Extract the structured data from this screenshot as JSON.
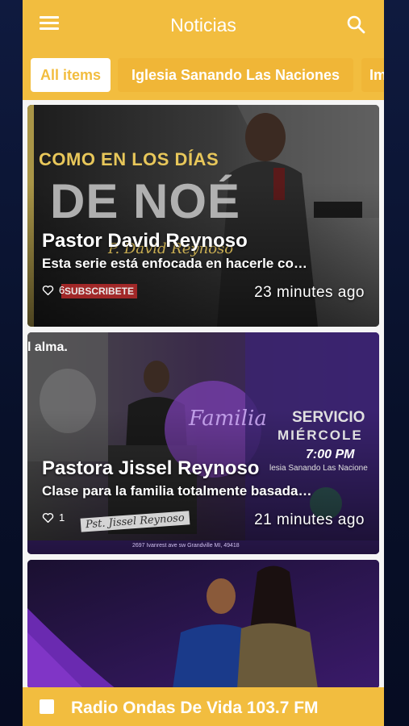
{
  "appbar": {
    "title": "Noticias"
  },
  "tabs": [
    {
      "label": "All items",
      "active": true
    },
    {
      "label": "Iglesia Sanando Las Naciones",
      "active": false
    },
    {
      "label": "Im",
      "active": false
    }
  ],
  "cards": [
    {
      "title": "Pastor David Reynoso",
      "description": "Esta serie está enfocada en hacerle co…",
      "likes": "6",
      "time": "23 minutes ago",
      "art": {
        "headline": "COMO EN LOS DÍAS",
        "big": "DE NOÉ",
        "script": "P. David Reynoso",
        "subscribe": "SUBSCRIBETE"
      }
    },
    {
      "title": "Pastora Jissel Reynoso",
      "description": "Clase para la familia totalmente basada…",
      "likes": "1",
      "time": "21 minutes ago",
      "art": {
        "top_left": "l alma.",
        "servicio": "SERVICIO",
        "miercoles": "MIÉRCOLE",
        "hour": "7:00 PM",
        "church": "lesia Sanando Las Nacione",
        "script": "Pst. Jissel Reynoso",
        "familia": "Familia",
        "address": "2697 Ivanrest ave sw Grandville MI, 49418"
      }
    },
    {
      "title": "",
      "description": "",
      "likes": "",
      "time": ""
    }
  ],
  "player": {
    "title": "Radio Ondas De Vida 103.7 FM"
  },
  "colors": {
    "accent": "#f2bd3f",
    "background": "#0b1330"
  }
}
